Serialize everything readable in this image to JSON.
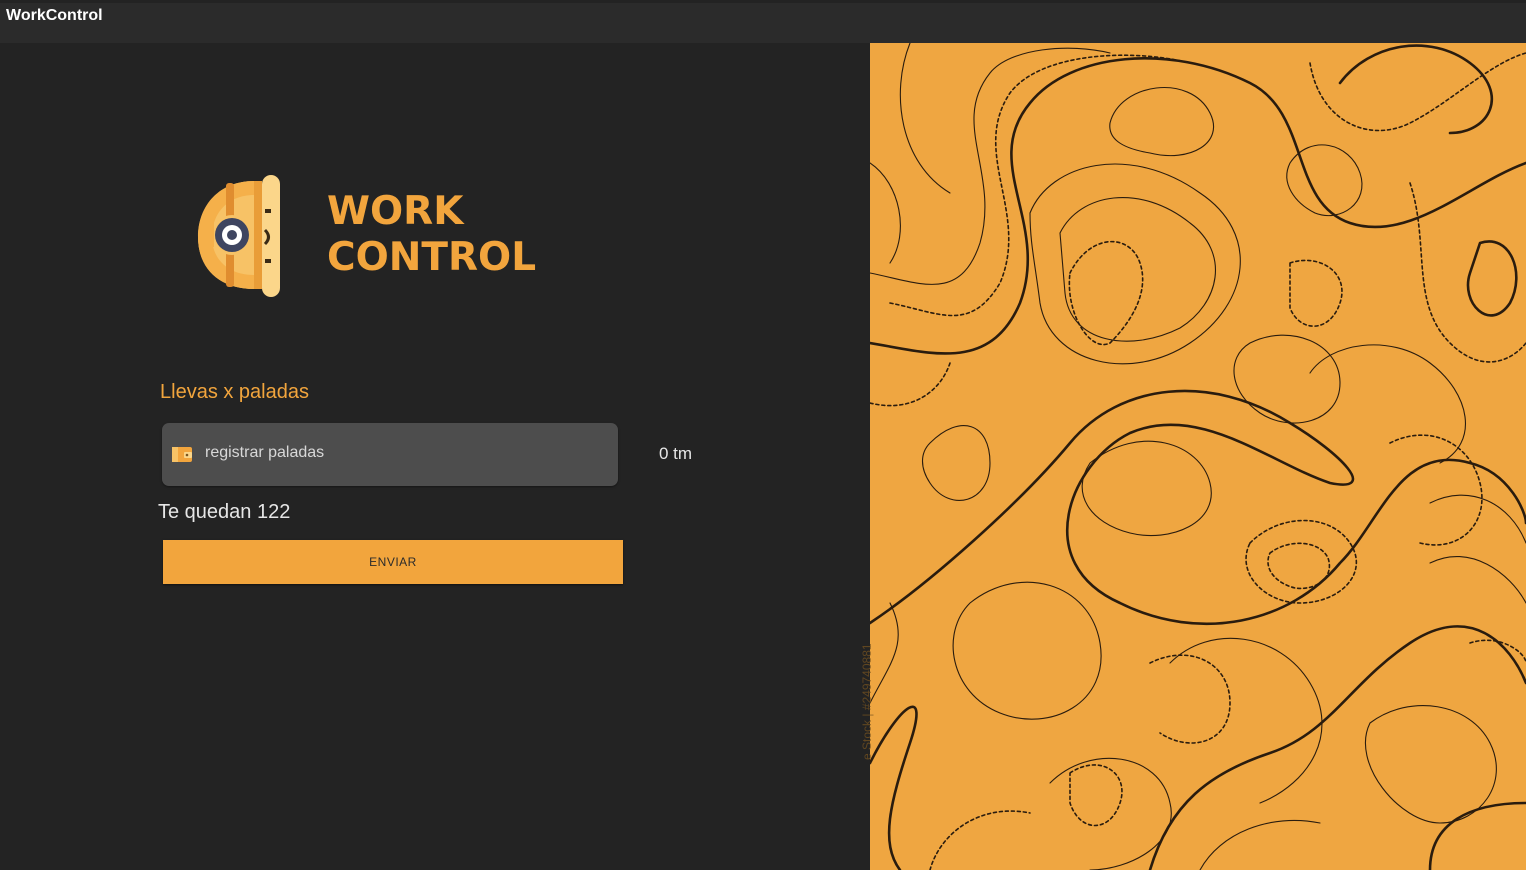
{
  "window": {
    "title": "WorkControl"
  },
  "logo": {
    "line1": "WORK",
    "line2": "CONTROL",
    "icon": "miner-helmet-icon"
  },
  "form": {
    "progress_label": "Llevas x paladas",
    "input_placeholder": "registrar paladas",
    "input_icon": "wallet-icon",
    "unit_value": "0 tm",
    "remaining_text": "Te quedan 122",
    "submit_label": "ENVIAR"
  },
  "decor": {
    "watermark": "e Stock | #249740881"
  },
  "colors": {
    "accent": "#f2a53d",
    "background": "#232323",
    "input_background": "#4d4d4d",
    "topo_background": "#efa641",
    "topo_lines": "#2a1c0e"
  }
}
